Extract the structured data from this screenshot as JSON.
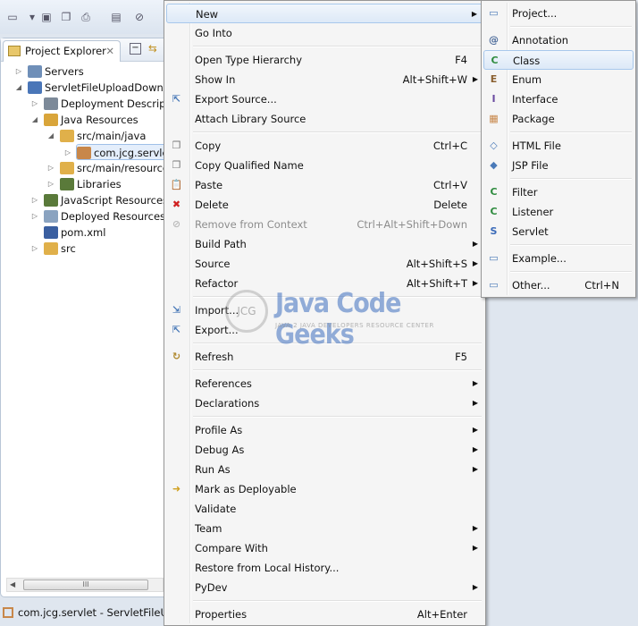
{
  "toolbar": {
    "icons": [
      "new-wizard-icon",
      "dropdown-icon",
      "save-icon",
      "save-all-icon",
      "print-icon",
      "binary-icon",
      "skip-breakpoints-icon"
    ]
  },
  "explorer": {
    "tab_label": "Project Explorer",
    "tree": [
      {
        "label": "Servers",
        "depth": 0,
        "toggle": "collapsed",
        "icon": "folder-icon",
        "color": "#6f8fb8"
      },
      {
        "label": "ServletFileUploadDownlo",
        "depth": 0,
        "toggle": "expanded",
        "icon": "maven-project-icon",
        "color": "#4a76b8"
      },
      {
        "label": "Deployment Descript",
        "depth": 1,
        "toggle": "collapsed",
        "icon": "deployment-descriptor-icon",
        "color": "#7d8a99"
      },
      {
        "label": "Java Resources",
        "depth": 1,
        "toggle": "expanded",
        "icon": "java-resources-icon",
        "color": "#d9a53a"
      },
      {
        "label": "src/main/java",
        "depth": 2,
        "toggle": "expanded",
        "icon": "source-folder-icon",
        "color": "#e0b04a"
      },
      {
        "label": "com.jcg.servlet",
        "depth": 3,
        "toggle": "collapsed",
        "icon": "package-icon",
        "color": "#c8874a",
        "selected": true
      },
      {
        "label": "src/main/resource",
        "depth": 2,
        "toggle": "collapsed",
        "icon": "source-folder-icon",
        "color": "#e0b04a"
      },
      {
        "label": "Libraries",
        "depth": 2,
        "toggle": "collapsed",
        "icon": "libraries-icon",
        "color": "#5a7a3a"
      },
      {
        "label": "JavaScript Resources",
        "depth": 1,
        "toggle": "collapsed",
        "icon": "libraries-icon",
        "color": "#5a7a3a"
      },
      {
        "label": "Deployed Resources",
        "depth": 1,
        "toggle": "collapsed",
        "icon": "deployed-resources-icon",
        "color": "#8aa3c0"
      },
      {
        "label": "pom.xml",
        "depth": 1,
        "toggle": "none",
        "icon": "maven-file-icon",
        "color": "#3a5fa0"
      },
      {
        "label": "src",
        "depth": 1,
        "toggle": "collapsed",
        "icon": "folder-icon",
        "color": "#e0b04a"
      }
    ],
    "scroll_thumb": "III"
  },
  "status": {
    "text": "com.jcg.servlet - ServletFileUpl"
  },
  "context_menu": [
    {
      "label": "New",
      "arrow": true,
      "highlight": true
    },
    {
      "label": "Go Into"
    },
    {
      "sep": true
    },
    {
      "label": "Open Type Hierarchy",
      "shortcut": "F4"
    },
    {
      "label": "Show In",
      "shortcut": "Alt+Shift+W",
      "arrow": true
    },
    {
      "label": "Export Source...",
      "icon": "export-source-icon",
      "glyph": "⇱",
      "color": "#4a7ab8"
    },
    {
      "label": "Attach Library Source"
    },
    {
      "sep": true
    },
    {
      "label": "Copy",
      "shortcut": "Ctrl+C",
      "icon": "copy-icon",
      "glyph": "❐",
      "color": "#777"
    },
    {
      "label": "Copy Qualified Name",
      "icon": "copy-qualified-icon",
      "glyph": "❐",
      "color": "#777"
    },
    {
      "label": "Paste",
      "shortcut": "Ctrl+V",
      "icon": "paste-icon",
      "glyph": "📋",
      "color": "#a08040"
    },
    {
      "label": "Delete",
      "shortcut": "Delete",
      "icon": "delete-icon",
      "glyph": "✖",
      "color": "#d02020"
    },
    {
      "label": "Remove from Context",
      "shortcut": "Ctrl+Alt+Shift+Down",
      "disabled": true,
      "icon": "remove-context-icon",
      "glyph": "⊘",
      "color": "#bbb"
    },
    {
      "label": "Build Path",
      "arrow": true
    },
    {
      "label": "Source",
      "shortcut": "Alt+Shift+S",
      "arrow": true
    },
    {
      "label": "Refactor",
      "shortcut": "Alt+Shift+T",
      "arrow": true
    },
    {
      "sep": true
    },
    {
      "label": "Import...",
      "icon": "import-icon",
      "glyph": "⇲",
      "color": "#4a7ab8"
    },
    {
      "label": "Export...",
      "icon": "export-icon",
      "glyph": "⇱",
      "color": "#4a7ab8"
    },
    {
      "sep": true
    },
    {
      "label": "Refresh",
      "shortcut": "F5",
      "icon": "refresh-icon",
      "glyph": "↻",
      "color": "#b08a30"
    },
    {
      "sep": true
    },
    {
      "label": "References",
      "arrow": true
    },
    {
      "label": "Declarations",
      "arrow": true
    },
    {
      "sep": true
    },
    {
      "label": "Profile As",
      "arrow": true
    },
    {
      "label": "Debug As",
      "arrow": true
    },
    {
      "label": "Run As",
      "arrow": true
    },
    {
      "label": "Mark as Deployable",
      "icon": "mark-deployable-icon",
      "glyph": "➜",
      "color": "#d0a020"
    },
    {
      "label": "Validate"
    },
    {
      "label": "Team",
      "arrow": true
    },
    {
      "label": "Compare With",
      "arrow": true
    },
    {
      "label": "Restore from Local History..."
    },
    {
      "label": "PyDev",
      "arrow": true
    },
    {
      "sep": true
    },
    {
      "label": "Properties",
      "shortcut": "Alt+Enter"
    }
  ],
  "submenu": [
    {
      "label": "Project...",
      "icon": "new-project-icon",
      "glyph": "▭",
      "color": "#4a7ab8"
    },
    {
      "sep": true
    },
    {
      "label": "Annotation",
      "icon": "annotation-icon",
      "glyph": "@",
      "color": "#4a6a9a"
    },
    {
      "label": "Class",
      "icon": "class-icon",
      "glyph": "C",
      "color": "#2e8b3e",
      "highlight": true
    },
    {
      "label": "Enum",
      "icon": "enum-icon",
      "glyph": "E",
      "color": "#8a6030"
    },
    {
      "label": "Interface",
      "icon": "interface-icon",
      "glyph": "I",
      "color": "#6a4aa0"
    },
    {
      "label": "Package",
      "icon": "package-icon",
      "glyph": "▦",
      "color": "#c8874a"
    },
    {
      "sep": true
    },
    {
      "label": "HTML File",
      "icon": "html-file-icon",
      "glyph": "◇",
      "color": "#4a7ab8"
    },
    {
      "label": "JSP File",
      "icon": "jsp-file-icon",
      "glyph": "◆",
      "color": "#4a7ab8"
    },
    {
      "sep": true
    },
    {
      "label": "Filter",
      "icon": "filter-icon",
      "glyph": "C",
      "color": "#2e8b3e"
    },
    {
      "label": "Listener",
      "icon": "listener-icon",
      "glyph": "C",
      "color": "#2e8b3e"
    },
    {
      "label": "Servlet",
      "icon": "servlet-icon",
      "glyph": "S",
      "color": "#3a6ab8"
    },
    {
      "sep": true
    },
    {
      "label": "Example...",
      "icon": "example-icon",
      "glyph": "▭",
      "color": "#4a7ab8"
    },
    {
      "sep": true
    },
    {
      "label": "Other...",
      "shortcut": "Ctrl+N",
      "icon": "other-wizard-icon",
      "glyph": "▭",
      "color": "#4a7ab8"
    }
  ],
  "watermark": {
    "logo": "JCG",
    "title": "Java Code Geeks",
    "subtitle": "JAVA 2 JAVA DEVELOPERS RESOURCE CENTER"
  }
}
